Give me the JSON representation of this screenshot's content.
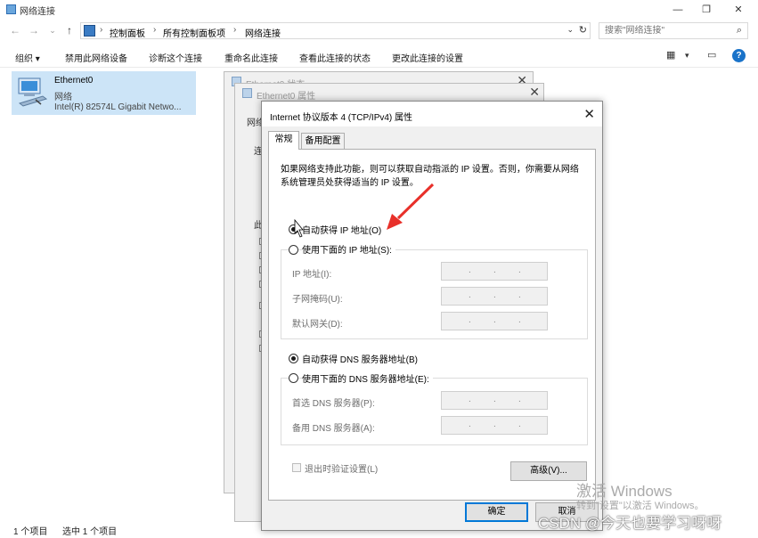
{
  "window": {
    "title": "网络连接",
    "minimize": "—",
    "restore": "❐",
    "close": "✕"
  },
  "nav": {
    "back": "←",
    "forward": "→",
    "dropdown": "⌄",
    "up": "↑"
  },
  "address": {
    "crumbs": [
      "控制面板",
      "所有控制面板项",
      "网络连接"
    ],
    "separator": "›",
    "dropdown": "⌄",
    "refresh": "↻"
  },
  "search": {
    "placeholder": "搜索\"网络连接\"",
    "icon": "⌕"
  },
  "toolbar": {
    "organize": "组织 ▾",
    "items": [
      "禁用此网络设备",
      "诊断这个连接",
      "重命名此连接",
      "查看此连接的状态",
      "更改此连接的设置"
    ],
    "view_icon": "▦",
    "view_dropdown": "▾",
    "pane_icon": "▭",
    "help": "?"
  },
  "adapter": {
    "name": "Ethernet0",
    "type": "网络",
    "device": "Intel(R) 82574L Gigabit Netwo..."
  },
  "status": {
    "count": "1 个项目",
    "selected": "选中 1 个项目"
  },
  "bg_dialogs": {
    "status_title": "Ethernet0 状态",
    "props_title": "Ethernet0 属性",
    "close": "✕",
    "peek_tab": "网络",
    "peek_conn": "连",
    "peek_items": "此"
  },
  "ipv4_dialog": {
    "title": "Internet 协议版本 4 (TCP/IPv4) 属性",
    "close": "✕",
    "tabs": [
      "常规",
      "备用配置"
    ],
    "description": "如果网络支持此功能，则可以获取自动指派的 IP 设置。否则，你需要从网络系统管理员处获得适当的 IP 设置。",
    "auto_ip": "自动获得 IP 地址(O)",
    "manual_ip": "使用下面的 IP 地址(S):",
    "ip_address": "IP 地址(I):",
    "subnet_mask": "子网掩码(U):",
    "gateway": "默认网关(D):",
    "auto_dns": "自动获得 DNS 服务器地址(B)",
    "manual_dns": "使用下面的 DNS 服务器地址(E):",
    "preferred_dns": "首选 DNS 服务器(P):",
    "alternate_dns": "备用 DNS 服务器(A):",
    "validate": "退出时验证设置(L)",
    "advanced": "高级(V)...",
    "ok": "确定",
    "cancel": "取消",
    "ip_dots": "."
  },
  "overlay": {
    "activate_title": "激活 Windows",
    "activate_sub": "转到\"设置\"以激活 Windows。",
    "csdn": "CSDN @今天也要学习呀呀"
  },
  "colors": {
    "selection": "#cce4f7",
    "accent": "#0078d7",
    "arrow": "#e8302a"
  }
}
